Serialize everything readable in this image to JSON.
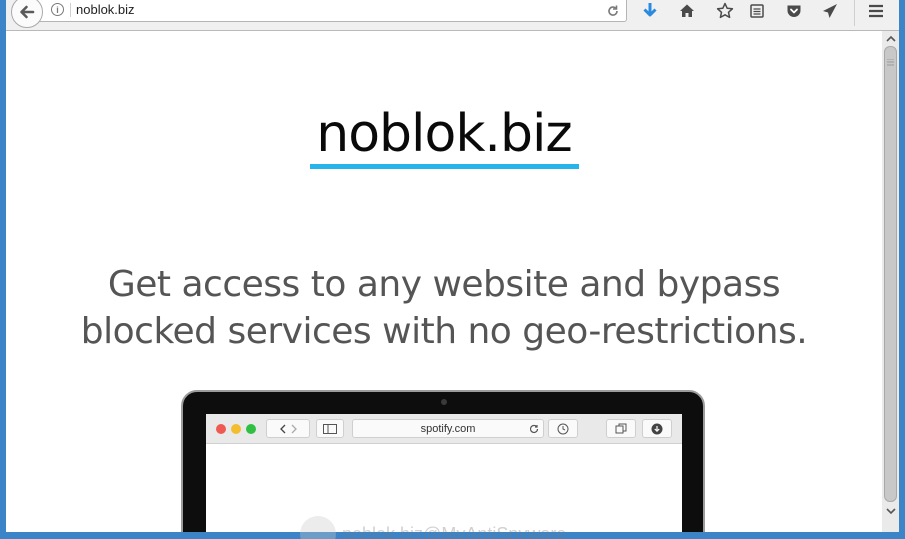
{
  "browser": {
    "url": "noblok.biz",
    "icons": {
      "back": "back-arrow-icon",
      "info": "info-icon",
      "reload": "reload-icon",
      "download": "download-icon",
      "home": "home-icon",
      "bookmark": "star-icon",
      "reading_list": "reading-list-icon",
      "pocket": "pocket-icon",
      "send": "send-icon",
      "menu": "hamburger-menu-icon"
    },
    "info_glyph": "i"
  },
  "page": {
    "title": "noblok.biz",
    "tagline": "Get access to any website and bypass blocked services with no geo-restrictions.",
    "accent_color": "#27b4ea",
    "mockup": {
      "url": "spotify.com",
      "dots": [
        "#ee5a52",
        "#f4bc2f",
        "#2fc043"
      ]
    }
  },
  "watermark": {
    "text": "noblok.biz@MyAntiSpyware"
  }
}
